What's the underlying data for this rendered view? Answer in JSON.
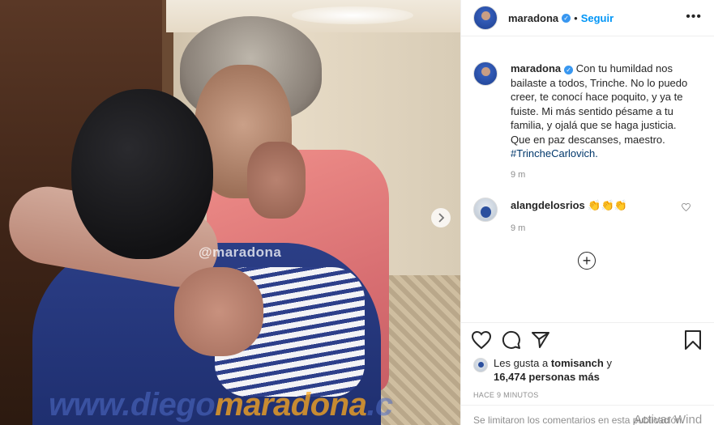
{
  "post": {
    "image_watermark_small": "@maradona",
    "image_watermark_big_part1": "www.diego",
    "image_watermark_big_part2": "maradona",
    "image_watermark_big_part3": ".c",
    "next_arrow_icon": "chevron-right-icon"
  },
  "header": {
    "username": "maradona",
    "verified": "verified-badge-icon",
    "dot": "•",
    "follow_label": "Seguir",
    "more_icon": "ellipsis-icon",
    "more_glyph": "•••"
  },
  "caption": {
    "username": "maradona",
    "text": "Con tu humildad nos bailaste a todos, Trinche. No lo puedo creer, te conocí hace poquito, y ya te fuiste. Mi más sentido pésame a tu familia, y ojalá que se haga justicia. Que en paz descanses, maestro.",
    "hashtag": "#TrincheCarlovich.",
    "time": "9 m"
  },
  "comments": [
    {
      "username": "alangdelosrios",
      "text": "👏👏👏",
      "time": "9 m",
      "like_icon": "heart-outline-icon"
    }
  ],
  "load_more_icon": "plus-circle-icon",
  "load_more_glyph": "+",
  "actions": {
    "like_icon": "heart-outline-icon",
    "comment_icon": "speech-bubble-icon",
    "share_icon": "paper-plane-icon",
    "save_icon": "bookmark-icon"
  },
  "likes": {
    "prefix": "Les gusta a ",
    "user": "tomisanch",
    "mid": " y",
    "count_text": "16,474 personas más"
  },
  "posted_ago": "HACE 9 MINUTOS",
  "comment_input_placeholder": "Se limitaron los comentarios en esta publicación.",
  "os_overlay": "Activar Wind"
}
